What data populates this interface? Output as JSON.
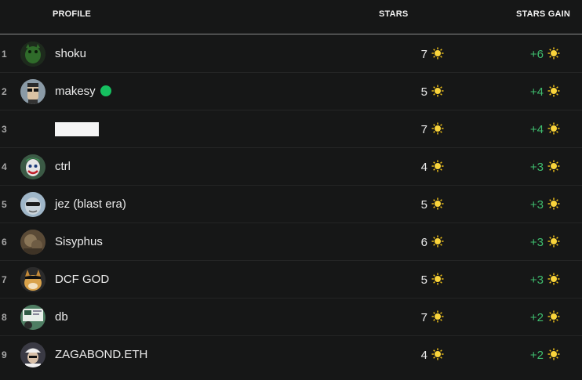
{
  "header": {
    "profile": "PROFILE",
    "stars": "STARS",
    "stars_gain": "STARS GAIN"
  },
  "accent": {
    "gain_color": "#3fbd6e",
    "online_color": "#16c060",
    "star_icon": "sun-star-icon"
  },
  "rows": [
    {
      "rank": "1",
      "name": "shoku",
      "stars": "7",
      "gain": "+6",
      "avatar": "green-creature-avatar"
    },
    {
      "rank": "2",
      "name": "makesy",
      "stars": "5",
      "gain": "+4",
      "avatar": "glasses-man-avatar",
      "online": true
    },
    {
      "rank": "3",
      "name": "",
      "stars": "7",
      "gain": "+4",
      "avatar": "blank-avatar",
      "redacted": true
    },
    {
      "rank": "4",
      "name": "ctrl",
      "stars": "4",
      "gain": "+3",
      "avatar": "joker-avatar"
    },
    {
      "rank": "5",
      "name": "jez (blast era)",
      "stars": "5",
      "gain": "+3",
      "avatar": "sunglasses-avatar"
    },
    {
      "rank": "6",
      "name": "Sisyphus",
      "stars": "6",
      "gain": "+3",
      "avatar": "brown-avatar"
    },
    {
      "rank": "7",
      "name": "DCF GOD",
      "stars": "5",
      "gain": "+3",
      "avatar": "doge-avatar"
    },
    {
      "rank": "8",
      "name": "db",
      "stars": "7",
      "gain": "+2",
      "avatar": "screen-avatar"
    },
    {
      "rank": "9",
      "name": "ZAGABOND.ETH",
      "stars": "4",
      "gain": "+2",
      "avatar": "hat-man-avatar"
    }
  ]
}
